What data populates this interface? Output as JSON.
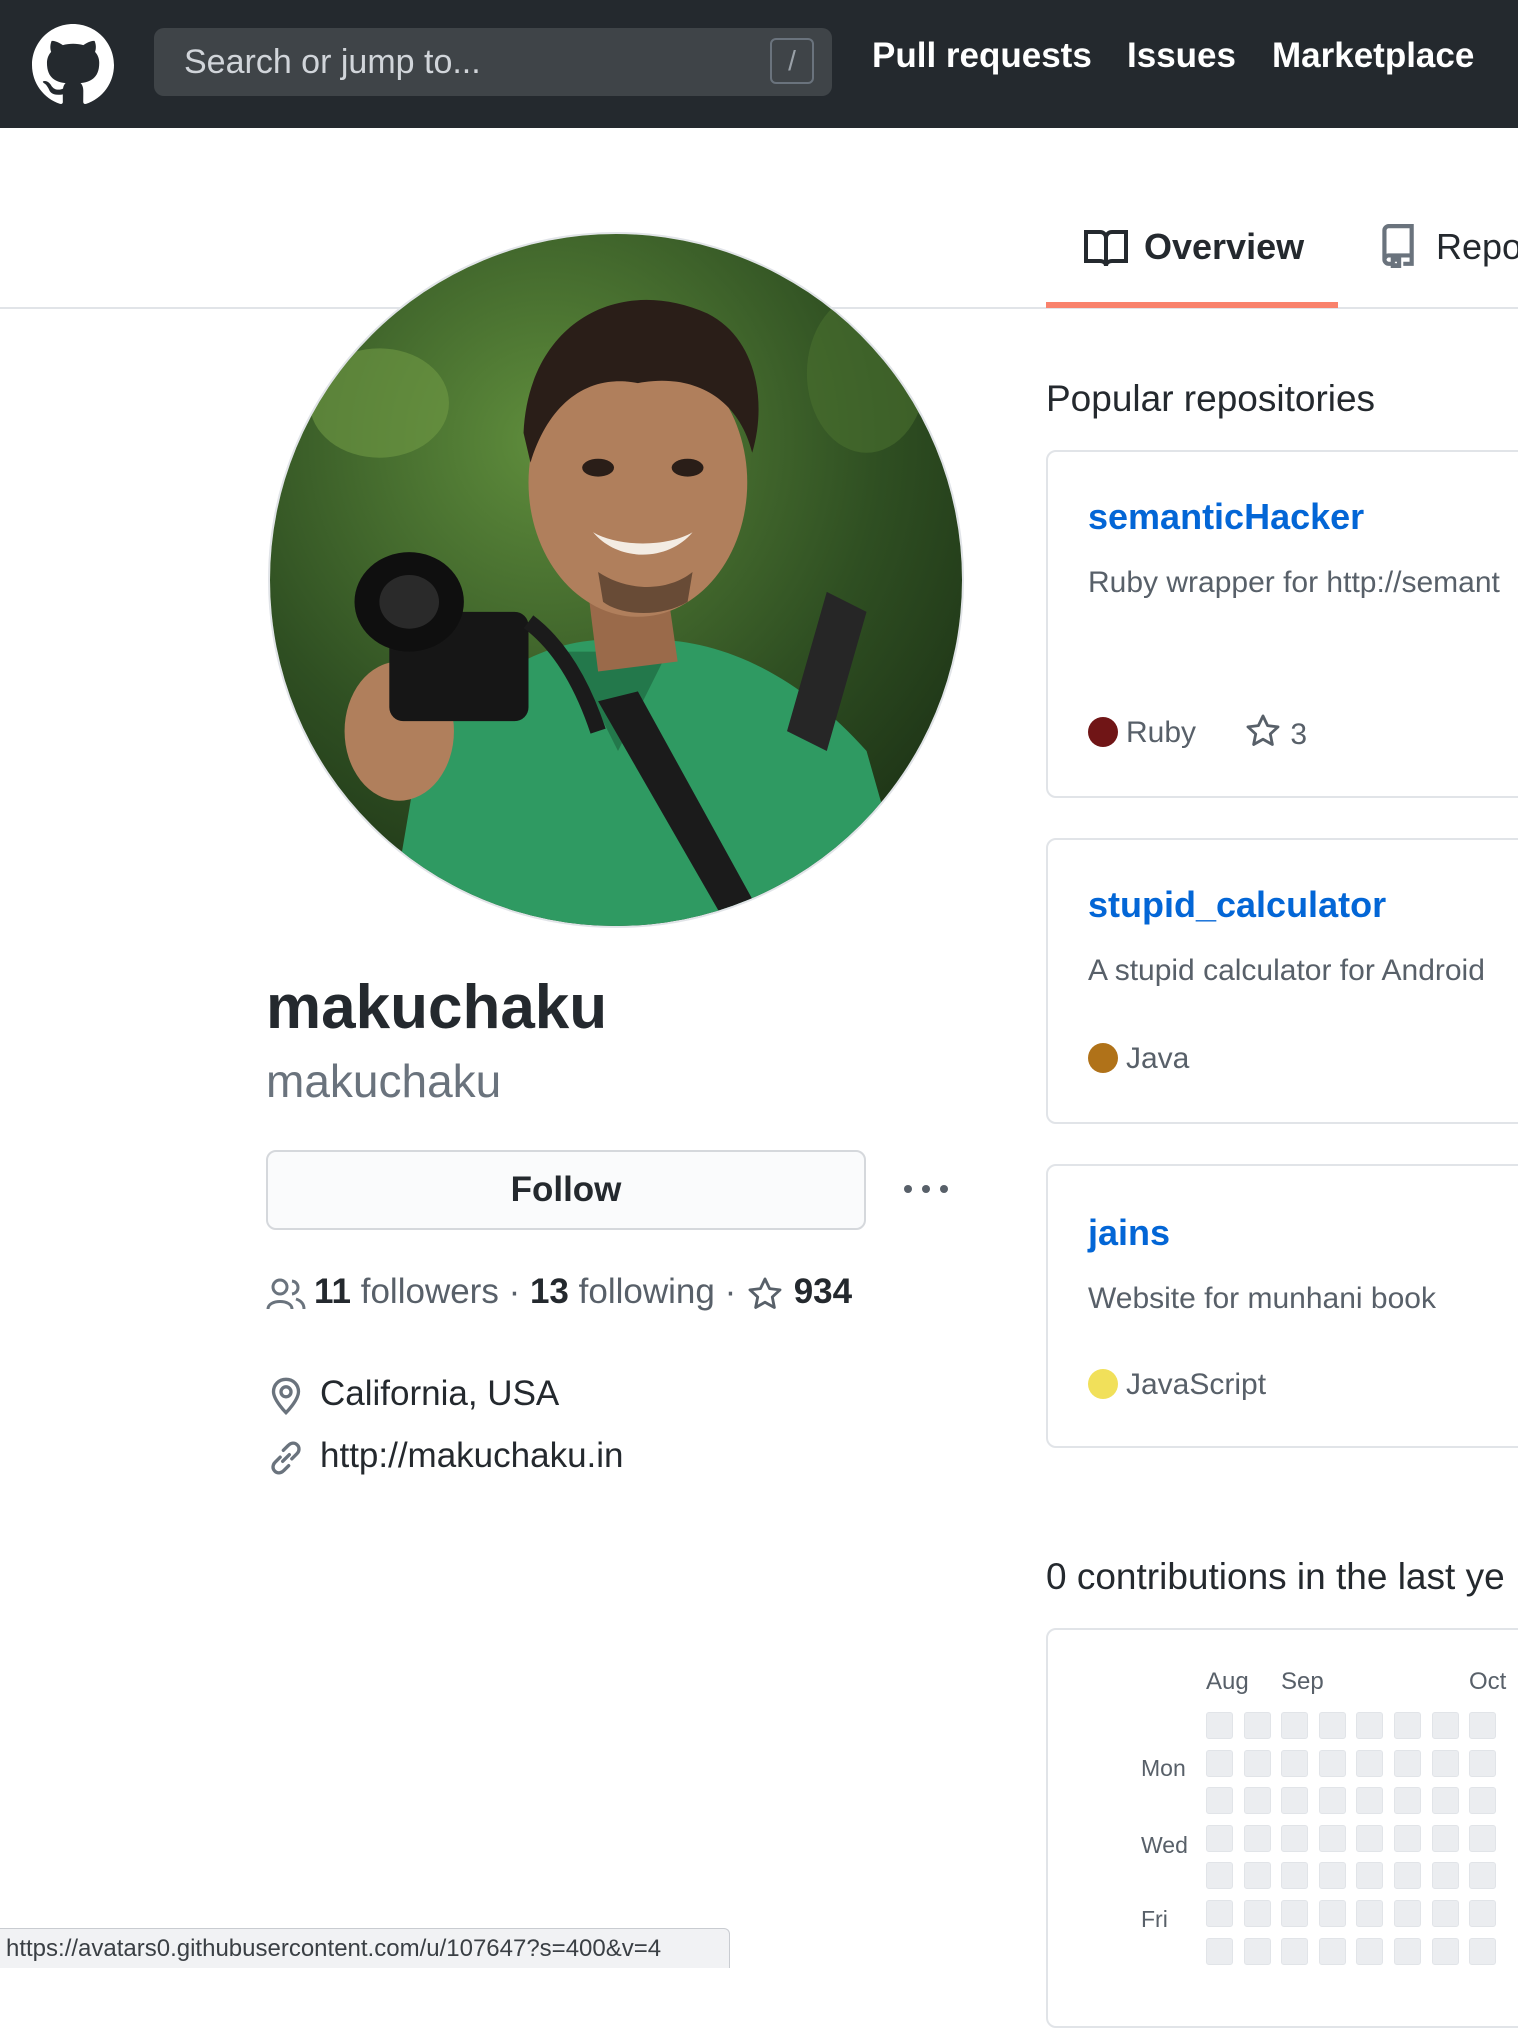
{
  "header": {
    "search_placeholder": "Search or jump to...",
    "search_shortcut": "/",
    "nav": [
      "Pull requests",
      "Issues",
      "Marketplace"
    ]
  },
  "tabs": {
    "overview": "Overview",
    "repositories": "Repo"
  },
  "profile": {
    "full_name": "makuchaku",
    "username": "makuchaku",
    "follow_label": "Follow",
    "followers_count": "11",
    "followers_label": "followers",
    "following_count": "13",
    "following_label": "following",
    "separator": "·",
    "stars_count": "934",
    "location": "California, USA",
    "website": "http://makuchaku.in"
  },
  "popular": {
    "title": "Popular repositories",
    "repos": [
      {
        "name": "semanticHacker",
        "description": "Ruby wrapper for http://semant",
        "language": "Ruby",
        "language_color": "#701516",
        "stars": "3"
      },
      {
        "name": "stupid_calculator",
        "description": "A stupid calculator for Android",
        "language": "Java",
        "language_color": "#b07219"
      },
      {
        "name": "jains",
        "description": "Website for munhani book",
        "language": "JavaScript",
        "language_color": "#f1e05a"
      }
    ]
  },
  "contributions": {
    "title": "0 contributions in the last ye",
    "months": [
      "Aug",
      "Sep",
      "Oct"
    ],
    "days": [
      "Mon",
      "Wed",
      "Fri"
    ]
  },
  "statusbar": {
    "url": "https://avatars0.githubusercontent.com/u/107647?s=400&v=4"
  },
  "colors": {
    "header_bg": "#24292e",
    "link_blue": "#0366d6",
    "tab_accent": "#f9826c"
  }
}
